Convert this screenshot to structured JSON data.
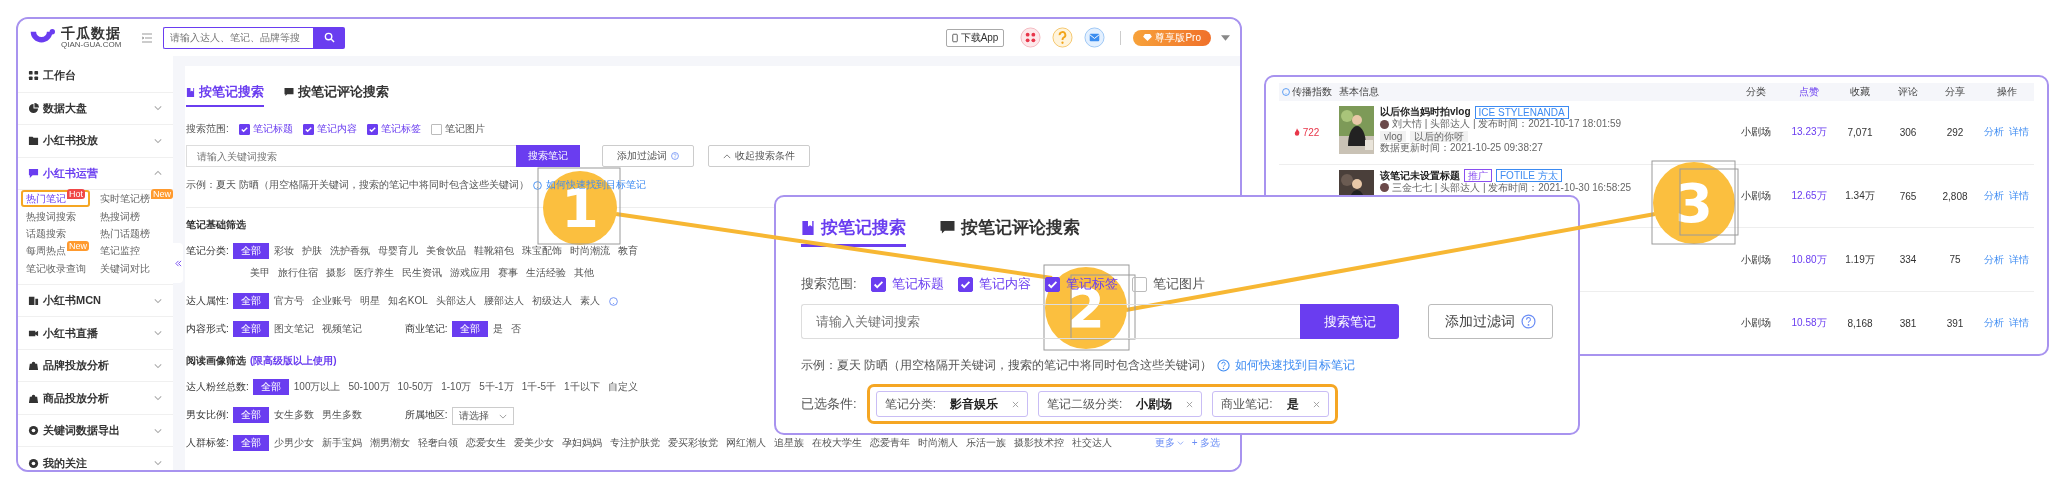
{
  "app": {
    "logo": {
      "name": "千瓜数据",
      "domain": "QIAN-GUA.COM"
    },
    "header": {
      "search_placeholder": "请输入达人、笔记、品牌等搜",
      "download": "下载App",
      "pro": "尊享版Pro"
    },
    "sidebar": [
      {
        "label": "工作台",
        "kind": "link",
        "selected": false
      },
      {
        "label": "数据大盘",
        "kind": "group",
        "selected": false,
        "expanded": false
      },
      {
        "label": "小红书投放",
        "kind": "group",
        "selected": false,
        "expanded": false
      },
      {
        "label": "小红书运营",
        "kind": "group",
        "selected": true,
        "expanded": true,
        "children": [
          {
            "label": "热门笔记",
            "selected": true,
            "highlighted": true,
            "badge": {
              "text": "Hot",
              "color": "#f04848"
            }
          },
          {
            "label": "实时笔记榜",
            "selected": false,
            "highlighted": false,
            "badge": {
              "text": "New",
              "color": "#ff9a2e"
            }
          },
          {
            "label": "热搜词搜索",
            "selected": false,
            "highlighted": false
          },
          {
            "label": "热搜词榜",
            "selected": false,
            "highlighted": false
          },
          {
            "label": "话题搜索",
            "selected": false,
            "highlighted": false
          },
          {
            "label": "热门话题榜",
            "selected": false,
            "highlighted": false
          },
          {
            "label": "每周热点",
            "selected": false,
            "highlighted": false,
            "badge": {
              "text": "New",
              "color": "#ff9a2e"
            }
          },
          {
            "label": "笔记监控",
            "selected": false,
            "highlighted": false
          },
          {
            "label": "笔记收录查询",
            "selected": false,
            "highlighted": false
          },
          {
            "label": "关键词对比",
            "selected": false,
            "highlighted": false
          }
        ]
      },
      {
        "label": "小红书MCN",
        "kind": "group",
        "selected": false,
        "expanded": false
      },
      {
        "label": "小红书直播",
        "kind": "group",
        "selected": false,
        "expanded": false
      },
      {
        "label": "品牌投放分析",
        "kind": "group",
        "selected": false,
        "expanded": false
      },
      {
        "label": "商品投放分析",
        "kind": "group",
        "selected": false,
        "expanded": false
      },
      {
        "label": "关键词数据导出",
        "kind": "group",
        "selected": false,
        "expanded": false
      },
      {
        "label": "我的关注",
        "kind": "group",
        "selected": false,
        "expanded": false
      }
    ],
    "tabs": [
      {
        "label": "按笔记搜索",
        "selected": true
      },
      {
        "label": "按笔记评论搜索",
        "selected": false
      }
    ],
    "scope": {
      "label": "搜索范围:",
      "options": [
        {
          "label": "笔记标题",
          "checked": true
        },
        {
          "label": "笔记内容",
          "checked": true
        },
        {
          "label": "笔记标签",
          "checked": true
        },
        {
          "label": "笔记图片",
          "checked": false
        }
      ]
    },
    "search": {
      "placeholder": "请输入关键词搜索",
      "button": "搜索笔记",
      "filter_button": "添加过滤词",
      "collapse_button": "收起搜索条件"
    },
    "example": {
      "text": "示例：夏天 防晒（用空格隔开关键词，搜索的笔记中将同时包含这些关键词）",
      "link": "如何快速找到目标笔记"
    },
    "sections": [
      {
        "title": "笔记基础筛选",
        "rows": [
          {
            "groups": [
              {
                "label": "笔记分类:",
                "lines": [
                  [
                    {
                      "label": "全部",
                      "selected": true
                    },
                    {
                      "label": "彩妆",
                      "selected": false
                    },
                    {
                      "label": "护肤",
                      "selected": false
                    },
                    {
                      "label": "洗护香氛",
                      "selected": false
                    },
                    {
                      "label": "母婴育儿",
                      "selected": false
                    },
                    {
                      "label": "美食饮品",
                      "selected": false
                    },
                    {
                      "label": "鞋靴箱包",
                      "selected": false
                    },
                    {
                      "label": "珠宝配饰",
                      "selected": false
                    },
                    {
                      "label": "时尚潮流",
                      "selected": false
                    },
                    {
                      "label": "教育",
                      "selected": false
                    }
                  ],
                  [
                    {
                      "label": "美甲",
                      "selected": false
                    },
                    {
                      "label": "旅行住宿",
                      "selected": false
                    },
                    {
                      "label": "摄影",
                      "selected": false
                    },
                    {
                      "label": "医疗养生",
                      "selected": false
                    },
                    {
                      "label": "民生资讯",
                      "selected": false
                    },
                    {
                      "label": "游戏应用",
                      "selected": false
                    },
                    {
                      "label": "赛事",
                      "selected": false
                    },
                    {
                      "label": "生活经验",
                      "selected": false
                    },
                    {
                      "label": "其他",
                      "selected": false
                    }
                  ]
                ]
              }
            ]
          },
          {
            "help": true,
            "groups": [
              {
                "label": "达人属性:",
                "lines": [
                  [
                    {
                      "label": "全部",
                      "selected": true
                    },
                    {
                      "label": "官方号",
                      "selected": false
                    },
                    {
                      "label": "企业账号",
                      "selected": false
                    },
                    {
                      "label": "明星",
                      "selected": false
                    },
                    {
                      "label": "知名KOL",
                      "selected": false
                    },
                    {
                      "label": "头部达人",
                      "selected": false
                    },
                    {
                      "label": "腰部达人",
                      "selected": false
                    },
                    {
                      "label": "初级达人",
                      "selected": false
                    },
                    {
                      "label": "素人",
                      "selected": false
                    }
                  ]
                ]
              }
            ]
          },
          {
            "groups": [
              {
                "label": "内容形式:",
                "lines": [
                  [
                    {
                      "label": "全部",
                      "selected": true
                    },
                    {
                      "label": "图文笔记",
                      "selected": false
                    },
                    {
                      "label": "视频笔记",
                      "selected": false
                    }
                  ]
                ]
              },
              {
                "label": "商业笔记:",
                "lines": [
                  [
                    {
                      "label": "全部",
                      "selected": true
                    },
                    {
                      "label": "是",
                      "selected": false
                    },
                    {
                      "label": "否",
                      "selected": false
                    }
                  ]
                ]
              }
            ]
          }
        ]
      },
      {
        "title": "阅读画像筛选",
        "note": "(限高级版以上使用)",
        "rows": [
          {
            "groups": [
              {
                "label": "达人粉丝总数:",
                "lines": [
                  [
                    {
                      "label": "全部",
                      "selected": true
                    },
                    {
                      "label": "100万以上",
                      "selected": false
                    },
                    {
                      "label": "50-100万",
                      "selected": false
                    },
                    {
                      "label": "10-50万",
                      "selected": false
                    },
                    {
                      "label": "1-10万",
                      "selected": false
                    },
                    {
                      "label": "5千-1万",
                      "selected": false
                    },
                    {
                      "label": "1千-5千",
                      "selected": false
                    },
                    {
                      "label": "1千以下",
                      "selected": false
                    },
                    {
                      "label": "自定义",
                      "selected": false
                    }
                  ]
                ]
              }
            ]
          },
          {
            "groups": [
              {
                "label": "男女比例:",
                "lines": [
                  [
                    {
                      "label": "全部",
                      "selected": true
                    },
                    {
                      "label": "女生多数",
                      "selected": false
                    },
                    {
                      "label": "男生多数",
                      "selected": false
                    }
                  ]
                ]
              },
              {
                "label": "所属地区:",
                "select": "请选择"
              }
            ]
          },
          {
            "more": "更多",
            "multi": "+ 多选",
            "groups": [
              {
                "label": "人群标签:",
                "lines": [
                  [
                    {
                      "label": "全部",
                      "selected": true
                    },
                    {
                      "label": "少男少女",
                      "selected": false
                    },
                    {
                      "label": "新手宝妈",
                      "selected": false
                    },
                    {
                      "label": "潮男潮女",
                      "selected": false
                    },
                    {
                      "label": "轻奢白领",
                      "selected": false
                    },
                    {
                      "label": "恋爱女生",
                      "selected": false
                    },
                    {
                      "label": "爱美少女",
                      "selected": false
                    },
                    {
                      "label": "孕妇妈妈",
                      "selected": false
                    },
                    {
                      "label": "专注护肤党",
                      "selected": false
                    },
                    {
                      "label": "爱买彩妆党",
                      "selected": false
                    },
                    {
                      "label": "网红潮人",
                      "selected": false
                    },
                    {
                      "label": "追星族",
                      "selected": false
                    },
                    {
                      "label": "在校大学生",
                      "selected": false
                    },
                    {
                      "label": "恋爱青年",
                      "selected": false
                    },
                    {
                      "label": "时尚潮人",
                      "selected": false
                    },
                    {
                      "label": "乐活一族",
                      "selected": false
                    },
                    {
                      "label": "摄影技术控",
                      "selected": false
                    },
                    {
                      "label": "社交达人",
                      "selected": false
                    }
                  ]
                ]
              }
            ]
          }
        ]
      }
    ]
  },
  "notes_table": {
    "columns": [
      {
        "label": "传播指数",
        "sorted": false,
        "help": true
      },
      {
        "label": "基本信息",
        "sorted": false
      },
      {
        "label": "分类",
        "sorted": false
      },
      {
        "label": "点赞",
        "sorted": true
      },
      {
        "label": "收藏",
        "sorted": false
      },
      {
        "label": "评论",
        "sorted": false
      },
      {
        "label": "分享",
        "sorted": false
      },
      {
        "label": "操作",
        "sorted": false
      }
    ],
    "rows": [
      {
        "index": "722",
        "thumbnail": {
          "kind": "picture"
        },
        "title": "以后你当妈时拍vlog",
        "tags": [
          {
            "text": "ICE STYLENANDA",
            "color": "#3d8bf2"
          }
        ],
        "author_line": "刘大情 | 头部达人 | 发布时间：2021-10-17 18:01:59",
        "keywords": [
          "vlog",
          "以后的你呀"
        ],
        "updated": "数据更新时间：2021-10-25 09:38:27",
        "category": "小剧场",
        "likes": "13.23万",
        "favorites": "7,071",
        "comments": "306",
        "shares": "292",
        "actions": [
          "分析",
          "详情"
        ]
      },
      {
        "thumbnail": {
          "kind": "picture"
        },
        "title": "该笔记未设置标题",
        "tags": [
          {
            "text": "推广",
            "color": "#8a4ff0"
          },
          {
            "text": "FOTILE 方太",
            "color": "#3d8bf2"
          }
        ],
        "author_line": "三金七七 | 头部达人 | 发布时间：2021-10-30 16:58:25",
        "category": "小剧场",
        "likes": "12.65万",
        "favorites": "1.34万",
        "comments": "765",
        "shares": "2,808",
        "actions": [
          "分析",
          "详情"
        ]
      },
      {
        "category": "小剧场",
        "likes": "10.80万",
        "favorites": "1.19万",
        "comments": "334",
        "shares": "75",
        "actions": [
          "分析",
          "详情"
        ]
      },
      {
        "category": "小剧场",
        "likes": "10.58万",
        "favorites": "8,168",
        "comments": "381",
        "shares": "391",
        "actions": [
          "分析",
          "详情"
        ]
      }
    ]
  },
  "zoomed_search": {
    "tabs": [
      {
        "label": "按笔记搜索",
        "selected": true
      },
      {
        "label": "按笔记评论搜索",
        "selected": false
      }
    ],
    "scope": {
      "label": "搜索范围:",
      "options": [
        {
          "label": "笔记标题",
          "checked": true
        },
        {
          "label": "笔记内容",
          "checked": true
        },
        {
          "label": "笔记标签",
          "checked": true
        },
        {
          "label": "笔记图片",
          "checked": false
        }
      ]
    },
    "search": {
      "placeholder": "请输入关键词搜索",
      "button": "搜索笔记",
      "filter_button": "添加过滤词"
    },
    "example": {
      "text": "示例：夏天 防晒（用空格隔开关键词，搜索的笔记中将同时包含这些关键词）",
      "link": "如何快速找到目标笔记"
    },
    "conditions": {
      "label": "已选条件:",
      "highlighted": true,
      "chips": [
        {
          "text": "笔记分类: **影音娱乐**"
        },
        {
          "text": "笔记二级分类: **小剧场**"
        },
        {
          "text": "商业笔记: **是**"
        }
      ]
    }
  },
  "annotations": [
    {
      "number": "1"
    },
    {
      "number": "2"
    },
    {
      "number": "3"
    }
  ]
}
